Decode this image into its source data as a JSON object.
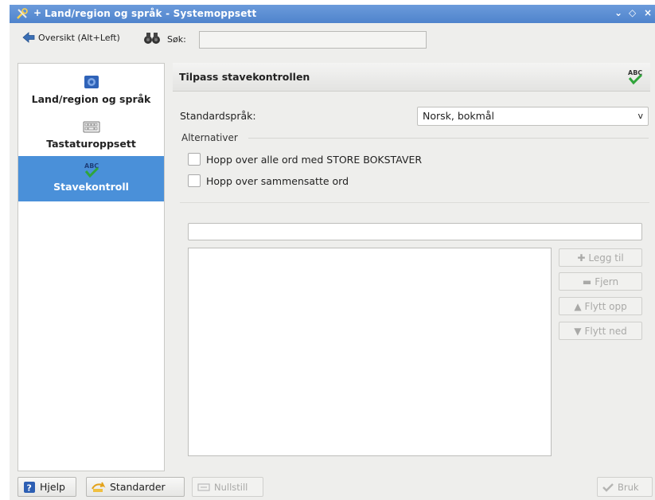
{
  "window": {
    "title": "Land/region og språk - Systemoppsett",
    "pin": "+",
    "controls": {
      "minimize": "⌄",
      "restore": "◇",
      "close": "×"
    }
  },
  "toolbar": {
    "back_label": "Oversikt (Alt+Left)",
    "search_label": "Søk:",
    "search_value": ""
  },
  "sidebar": {
    "items": [
      {
        "label": "Land/region og språk",
        "icon": "flag-icon",
        "selected": false
      },
      {
        "label": "Tastaturoppsett",
        "icon": "keyboard-icon",
        "selected": false
      },
      {
        "label": "Stavekontroll",
        "icon": "spellcheck-icon",
        "selected": true
      }
    ]
  },
  "panel": {
    "title": "Tilpass stavekontrollen",
    "standard_language_label": "Standardspråk:",
    "standard_language_value": "Norsk, bokmål",
    "select_arrow": "v",
    "options_group_label": "Alternativer",
    "options": [
      {
        "label": "Hopp over alle ord med STORE BOKSTAVER",
        "checked": false
      },
      {
        "label": "Hopp over sammensatte ord",
        "checked": false
      }
    ],
    "word_input_value": "",
    "buttons": {
      "add": "Legg til",
      "remove": "Fjern",
      "move_up": "Flytt opp",
      "move_down": "Flytt ned"
    }
  },
  "footer": {
    "help": "Hjelp",
    "defaults": "Standarder",
    "reset": "Nullstill",
    "apply": "Bruk"
  },
  "colors": {
    "titlebar": "#5a8dd3",
    "selection": "#4a90d9",
    "window_bg": "#eeeeec"
  }
}
